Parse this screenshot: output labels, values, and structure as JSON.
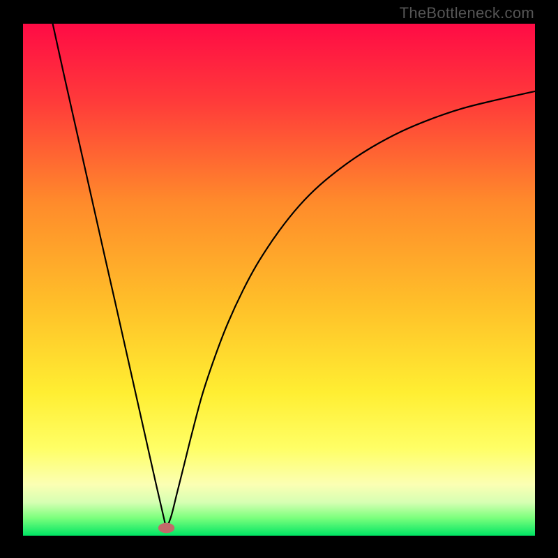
{
  "watermark": "TheBottleneck.com",
  "chart_data": {
    "type": "line",
    "title": "",
    "xlabel": "",
    "ylabel": "",
    "xlim": [
      0,
      100
    ],
    "ylim": [
      0,
      100
    ],
    "legend": false,
    "grid": false,
    "background_gradient": {
      "stops": [
        {
          "offset": 0.0,
          "color": "#ff0b45"
        },
        {
          "offset": 0.15,
          "color": "#ff3a3a"
        },
        {
          "offset": 0.35,
          "color": "#ff8b2b"
        },
        {
          "offset": 0.55,
          "color": "#ffc029"
        },
        {
          "offset": 0.72,
          "color": "#ffee32"
        },
        {
          "offset": 0.83,
          "color": "#ffff66"
        },
        {
          "offset": 0.9,
          "color": "#fbffb3"
        },
        {
          "offset": 0.935,
          "color": "#d6ffb3"
        },
        {
          "offset": 0.965,
          "color": "#7dff7d"
        },
        {
          "offset": 1.0,
          "color": "#00e564"
        }
      ]
    },
    "marker": {
      "x": 28.0,
      "y": 1.5,
      "rx": 1.6,
      "ry": 1.0,
      "color": "#c26a6a"
    },
    "series": [
      {
        "name": "left",
        "stroke": "#000000",
        "x": [
          5.8,
          8.0,
          10.0,
          12.0,
          14.0,
          16.0,
          18.0,
          20.0,
          22.0,
          24.0,
          26.0,
          27.5,
          28.0
        ],
        "y": [
          100.0,
          90.0,
          81.1,
          72.2,
          63.3,
          54.4,
          45.6,
          36.7,
          27.8,
          18.9,
          10.0,
          3.5,
          1.3
        ]
      },
      {
        "name": "right",
        "stroke": "#000000",
        "x": [
          28.0,
          29.0,
          30.0,
          31.5,
          33.0,
          35.0,
          37.5,
          40.0,
          43.0,
          46.0,
          50.0,
          54.0,
          58.0,
          63.0,
          68.0,
          74.0,
          80.0,
          86.0,
          92.0,
          100.0
        ],
        "y": [
          1.3,
          4.0,
          8.0,
          14.0,
          20.0,
          27.5,
          35.0,
          41.5,
          48.0,
          53.5,
          59.5,
          64.5,
          68.5,
          72.5,
          75.8,
          79.0,
          81.5,
          83.5,
          85.0,
          86.8
        ]
      }
    ]
  }
}
